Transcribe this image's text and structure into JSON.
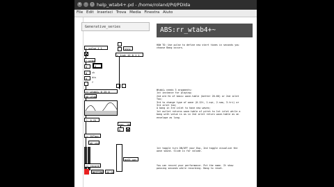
{
  "window": {
    "title": "help_wtab4+.pd  - /home/roland/Pd/PDIda",
    "menu": [
      "File",
      "Edit",
      "Inserisci",
      "Trova",
      "Media",
      "Finestra",
      "Aiuto"
    ],
    "buttons": {
      "close": "×",
      "minimize": "–",
      "maximize": "□"
    }
  },
  "patch": {
    "header": "Generative_series",
    "abs_title": "ABS:rr_wtab4+~",
    "objects": {
      "pulse": "r_pulse 1 1",
      "sync": "sync",
      "trigger": "r_trgt 12 0 1 1",
      "prbay": "r_prby",
      "num_a": "0",
      "num_b": "0",
      "num_c": "0",
      "label_ch": "ch",
      "label_dis": "dis",
      "num_d": "0",
      "label_f": "f",
      "wtab": "rr_wtab4+ 0 25 0",
      "wtab_sub": "bb-wtab",
      "mul": "*~ 0.25",
      "vsp": "vsp. 100",
      "zero_a": "0",
      "dac_toggle": "1",
      "rr_outmac": "rr_DUTmac~",
      "pb_user": "pb-user",
      "rr_record": "rr_record~",
      "sendfile": "mx01.wav",
      "waiting_label": "WAITING",
      "waiting_value": "00:00"
    },
    "notes": {
      "howto": "HOW TO: Use pulse to define new start times in seconds you\nchoose Bang occurs.",
      "args": "Wtab4+ needs 3 arguments:\n1st instance for playing;\n2nd are Hz of basic wave-table (better 20-60) or 2nd inlet\nToo;\n3rd to change type of wave (0-12t, 1-sqr, 2-saw, 3-tri) or\n3rd inlet too;\nA bang in 3rd inlet to have new waves;\n1st outlet returns wave-table of pitch to 1st inlet while a\nbang with value is as in 2nd inlet return wave-table as an\nenvelope as long.",
      "toggle": "1st toggle turn ON/OFF your Dsp, 2nd toggle visualize the\nwave sound. Slide is for volume.",
      "record": "You can record your performance. Put the name. It show\npassing seconds while recording. Bang to reset."
    }
  },
  "colors": {
    "abs_bg": "#4f4f4f",
    "vu_red": "#e82020",
    "vu_dark": "#2a2a2a",
    "graph_fill": "#c8c8c8"
  }
}
